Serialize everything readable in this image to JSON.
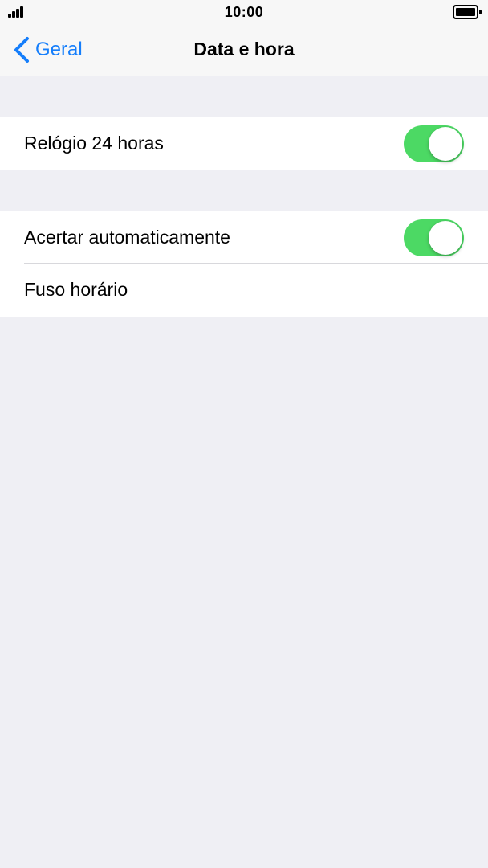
{
  "status_bar": {
    "time": "10:00",
    "signal_icon": "signal-bars-icon",
    "battery_icon": "battery-full-icon"
  },
  "nav": {
    "back_label": "Geral",
    "back_icon": "chevron-left-icon",
    "title": "Data e hora"
  },
  "settings": {
    "clock_24h": {
      "label": "Relógio 24 horas",
      "enabled": true
    },
    "auto_set": {
      "label": "Acertar automaticamente",
      "enabled": true
    },
    "time_zone": {
      "label": "Fuso horário"
    }
  },
  "colors": {
    "accent": "#157efb",
    "toggle_on": "#4cd964",
    "background": "#efeff4"
  }
}
